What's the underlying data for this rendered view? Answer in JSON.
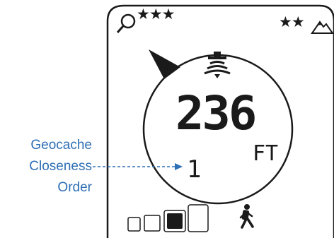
{
  "device": {
    "difficulty_stars": "★★★",
    "terrain_stars": "★★",
    "distance_value": "236",
    "distance_unit": "FT",
    "closeness_order": "1",
    "difficulty_rating": 2.5,
    "terrain_rating": 2,
    "icons": [
      "magnifier-icon",
      "mountain-icon",
      "compass-arrow-icon",
      "geocache-signal-icon",
      "hiker-icon",
      "zoom-boxes-icon"
    ]
  },
  "annotation": {
    "line1": "Geocache",
    "line2": "Closeness",
    "line3": "Order"
  },
  "colors": {
    "annotation": "#2e6fb5",
    "lcd": "#1a1a1a"
  }
}
